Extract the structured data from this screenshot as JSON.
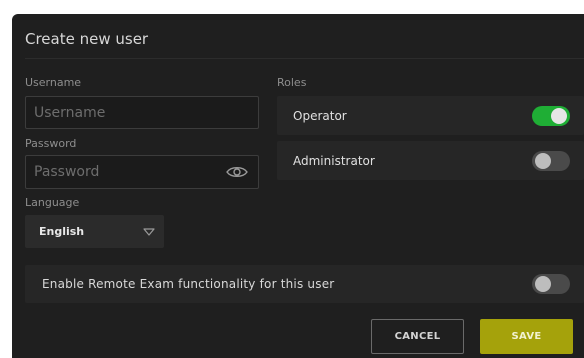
{
  "dialog": {
    "title": "Create new user"
  },
  "form": {
    "username_label": "Username",
    "username_placeholder": "Username",
    "username_value": "",
    "password_label": "Password",
    "password_placeholder": "Password",
    "password_value": "",
    "language_label": "Language",
    "language_selected": "English"
  },
  "roles": {
    "label": "Roles",
    "items": [
      {
        "label": "Operator",
        "enabled": true
      },
      {
        "label": "Administrator",
        "enabled": false
      }
    ]
  },
  "remote_exam": {
    "label": "Enable Remote Exam functionality for this user",
    "enabled": false
  },
  "actions": {
    "cancel_label": "CANCEL",
    "save_label": "SAVE"
  },
  "icons": {
    "password_visibility": "eye-icon",
    "language_dropdown": "chevron-down-icon"
  },
  "colors": {
    "toggle_on": "#1fae35",
    "save_button": "#a5a20b",
    "background": "#1f1f1f"
  }
}
